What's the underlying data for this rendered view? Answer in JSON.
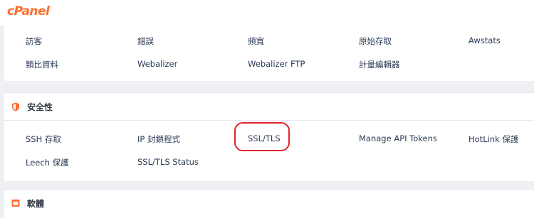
{
  "brand": {
    "logo_text": "cPanel",
    "accent_color": "#ff6c2c"
  },
  "stats": {
    "row1": [
      "訪客",
      "錯誤",
      "頻寬",
      "原始存取",
      "Awstats"
    ],
    "row2": [
      "類比資料",
      "Webalizer",
      "Webalizer FTP",
      "計量編輯器"
    ]
  },
  "security": {
    "icon": "shield-icon",
    "title": "安全性",
    "row1": [
      "SSH 存取",
      "IP 封鎖程式",
      "SSL/TLS",
      "Manage API Tokens",
      "HotLink 保護"
    ],
    "row2": [
      "Leech 保護",
      "SSL/TLS Status"
    ],
    "highlighted_item": "SSL/TLS",
    "highlight_color": "#e0242a"
  },
  "software": {
    "icon": "software-icon",
    "title": "軟體"
  }
}
